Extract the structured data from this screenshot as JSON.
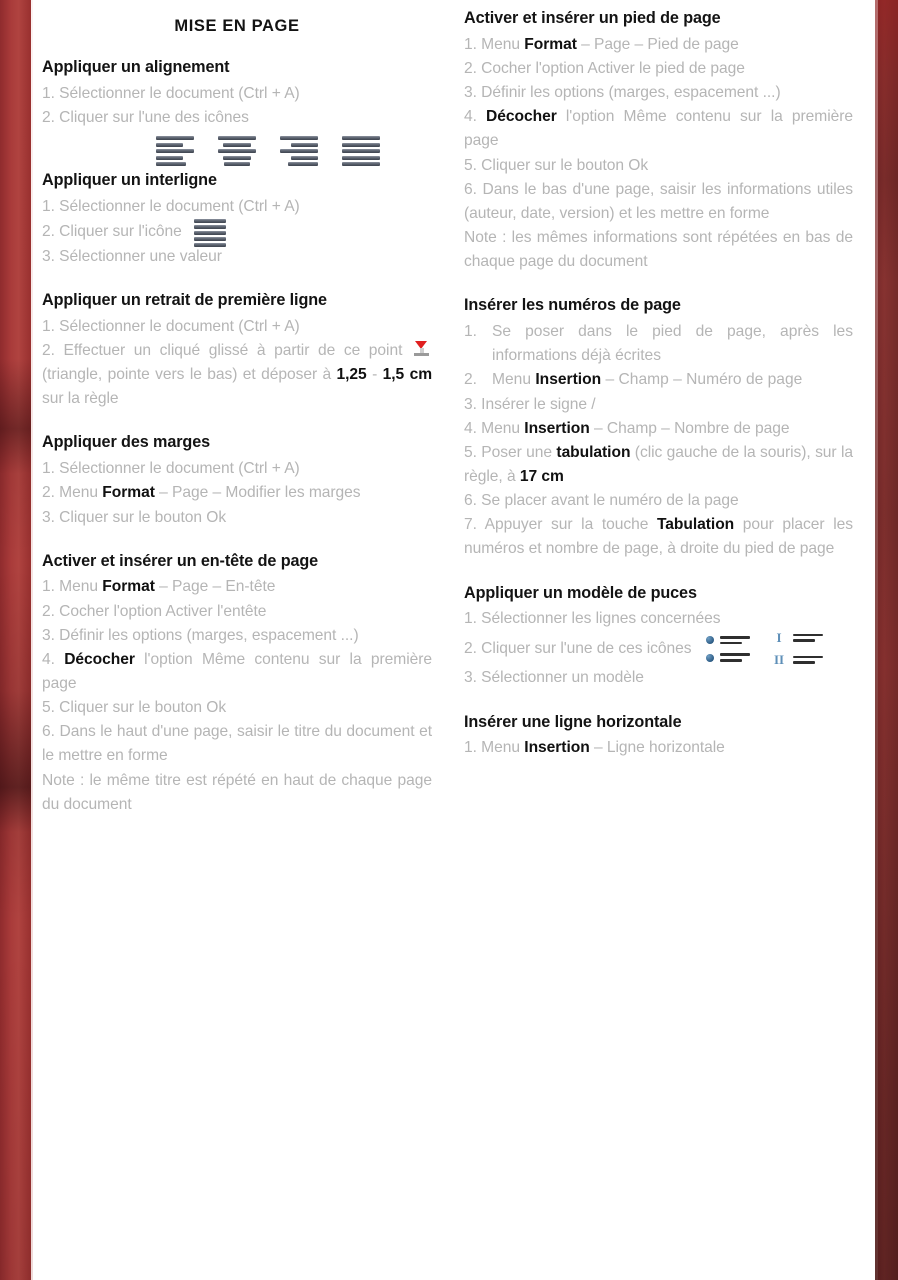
{
  "document": {
    "title": "MISE EN PAGE",
    "theme": {
      "accent": "#a93b3a",
      "sheet": "#ffffff",
      "body_text": "#b5b5b5",
      "heading_text": "#131313"
    }
  },
  "left_column": {
    "sections": [
      {
        "heading": "Appliquer un alignement",
        "steps": [
          "1. Sélectionner le document (Ctrl + A)",
          "2. Cliquer sur l'une des icônes"
        ],
        "icons": [
          "align-left-icon",
          "align-center-icon",
          "align-right-icon",
          "align-justify-icon"
        ]
      },
      {
        "heading": "Appliquer un interligne",
        "step1": "1. Sélectionner le document (Ctrl + A)",
        "step2": "2. Cliquer sur l'icône",
        "step3": "3. Sélectionner une valeur",
        "icon": "line-spacing-icon"
      },
      {
        "heading": "Appliquer un retrait de première ligne",
        "step1": "1. Sélectionner le document (Ctrl + A)",
        "step2_a": "2. Effectuer un cliqué glissé à partir de ce point",
        "step2_b": "(triangle, pointe vers le bas) et  déposer à ",
        "step2_bold1": "1,25",
        "step2_sep": " - ",
        "step2_bold2": "1,5 cm",
        "step2_c": " sur la règle",
        "icon": "first-line-indent-marker-icon"
      },
      {
        "heading": "Appliquer des marges",
        "step1": "1. Sélectionner le document (Ctrl + A)",
        "step2_a": "2. Menu ",
        "step2_bold": "Format",
        "step2_b": " – Page – Modifier les marges",
        "step3": "3. Cliquer sur le bouton Ok"
      },
      {
        "heading": "Activer et insérer un en-tête de page",
        "step1_a": "1.    Menu ",
        "step1_bold": "Format",
        "step1_b": " – Page – En-tête",
        "step2": "2. Cocher l'option Activer l'entête",
        "step3": "3.     Définir    les    options    (marges, espacement ...)",
        "step4_a": "4. ",
        "step4_bold": "Décocher",
        "step4_b": " l'option Même contenu sur la première page",
        "step5": "5. Cliquer sur le bouton Ok",
        "step6": "6. Dans le haut d'une page, saisir le titre du document et le mettre en forme",
        "note": "Note : le même titre est répété en haut de chaque page du document"
      }
    ]
  },
  "right_column": {
    "sections": [
      {
        "heading": "Activer et insérer un pied de page",
        "step1_a": "1.    Menu ",
        "step1_bold": "Format",
        "step1_b": " – Page – Pied de page",
        "step2": "2. Cocher l'option Activer le pied de page",
        "step3": "3. Définir les options (marges, espacement ...)",
        "step4_a": "4. ",
        "step4_bold": "Décocher",
        "step4_b": " l'option Même contenu sur la première page",
        "step5": "5. Cliquer sur le bouton Ok",
        "step6": "6. Dans le bas d'une page, saisir les informations utiles (auteur, date, version) et les mettre en forme",
        "note": "Note : les mêmes informations sont répétées en bas de chaque page du document"
      },
      {
        "heading": "Insérer les numéros de page",
        "item1_num": "1.",
        "item1_text": "Se poser dans le pied de page, après les informations déjà écrites",
        "item2_num": "2.",
        "item2_a": "Menu ",
        "item2_bold": "Insertion",
        "item2_b": " – Champ – Numéro de page",
        "step3": "3. Insérer le signe /",
        "step4_a": "4. Menu ",
        "step4_bold": "Insertion",
        "step4_b": " – Champ – Nombre de page",
        "step5_a": "5. Poser une ",
        "step5_bold": "tabulation",
        "step5_b": " (clic gauche de la souris), sur la règle, à ",
        "step5_bold2": "17 cm",
        "step6": "6. Se placer avant le numéro de la page",
        "step7_a": "7. Appuyer sur la touche ",
        "step7_bold": "Tabulation",
        "step7_b": " pour placer les numéros et nombre de page, à droite du pied de page"
      },
      {
        "heading": "Appliquer un modèle de puces",
        "step1": "1. Sélectionner les lignes concernées",
        "step2": "2. Cliquer sur l'une de ces icônes",
        "step3": "3. Sélectionner un modèle",
        "icons": [
          "bullet-list-icon",
          "numbered-list-icon"
        ],
        "numbered_glyphs": [
          "I",
          "II"
        ]
      },
      {
        "heading": "Insérer une ligne horizontale",
        "step1_a": "1.    Menu ",
        "step1_bold": "Insertion",
        "step1_b": " – Ligne horizontale"
      }
    ]
  }
}
